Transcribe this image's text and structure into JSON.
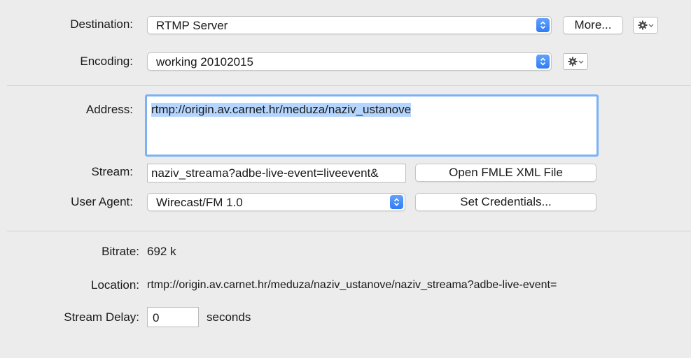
{
  "destination": {
    "label": "Destination:",
    "value": "RTMP Server",
    "more_label": "More..."
  },
  "encoding": {
    "label": "Encoding:",
    "value": "working 20102015"
  },
  "address": {
    "label": "Address:",
    "value": "rtmp://origin.av.carnet.hr/meduza/naziv_ustanove"
  },
  "stream": {
    "label": "Stream:",
    "value": "naziv_streama?adbe-live-event=liveevent&",
    "open_xml_label": "Open FMLE XML File"
  },
  "user_agent": {
    "label": "User Agent:",
    "value": "Wirecast/FM 1.0",
    "credentials_label": "Set Credentials..."
  },
  "bitrate": {
    "label": "Bitrate:",
    "value": "692 k"
  },
  "location": {
    "label": "Location:",
    "value": "rtmp://origin.av.carnet.hr/meduza/naziv_ustanove/naziv_streama?adbe-live-event="
  },
  "stream_delay": {
    "label": "Stream Delay:",
    "value": "0",
    "unit": "seconds"
  },
  "icons": {
    "gear": "gear-icon",
    "popup_arrows": "up-down-chevron-icon"
  },
  "colors": {
    "accent": "#2f7cf6",
    "focus_ring": "#7ab2f5",
    "selection": "#b4d5fe"
  }
}
